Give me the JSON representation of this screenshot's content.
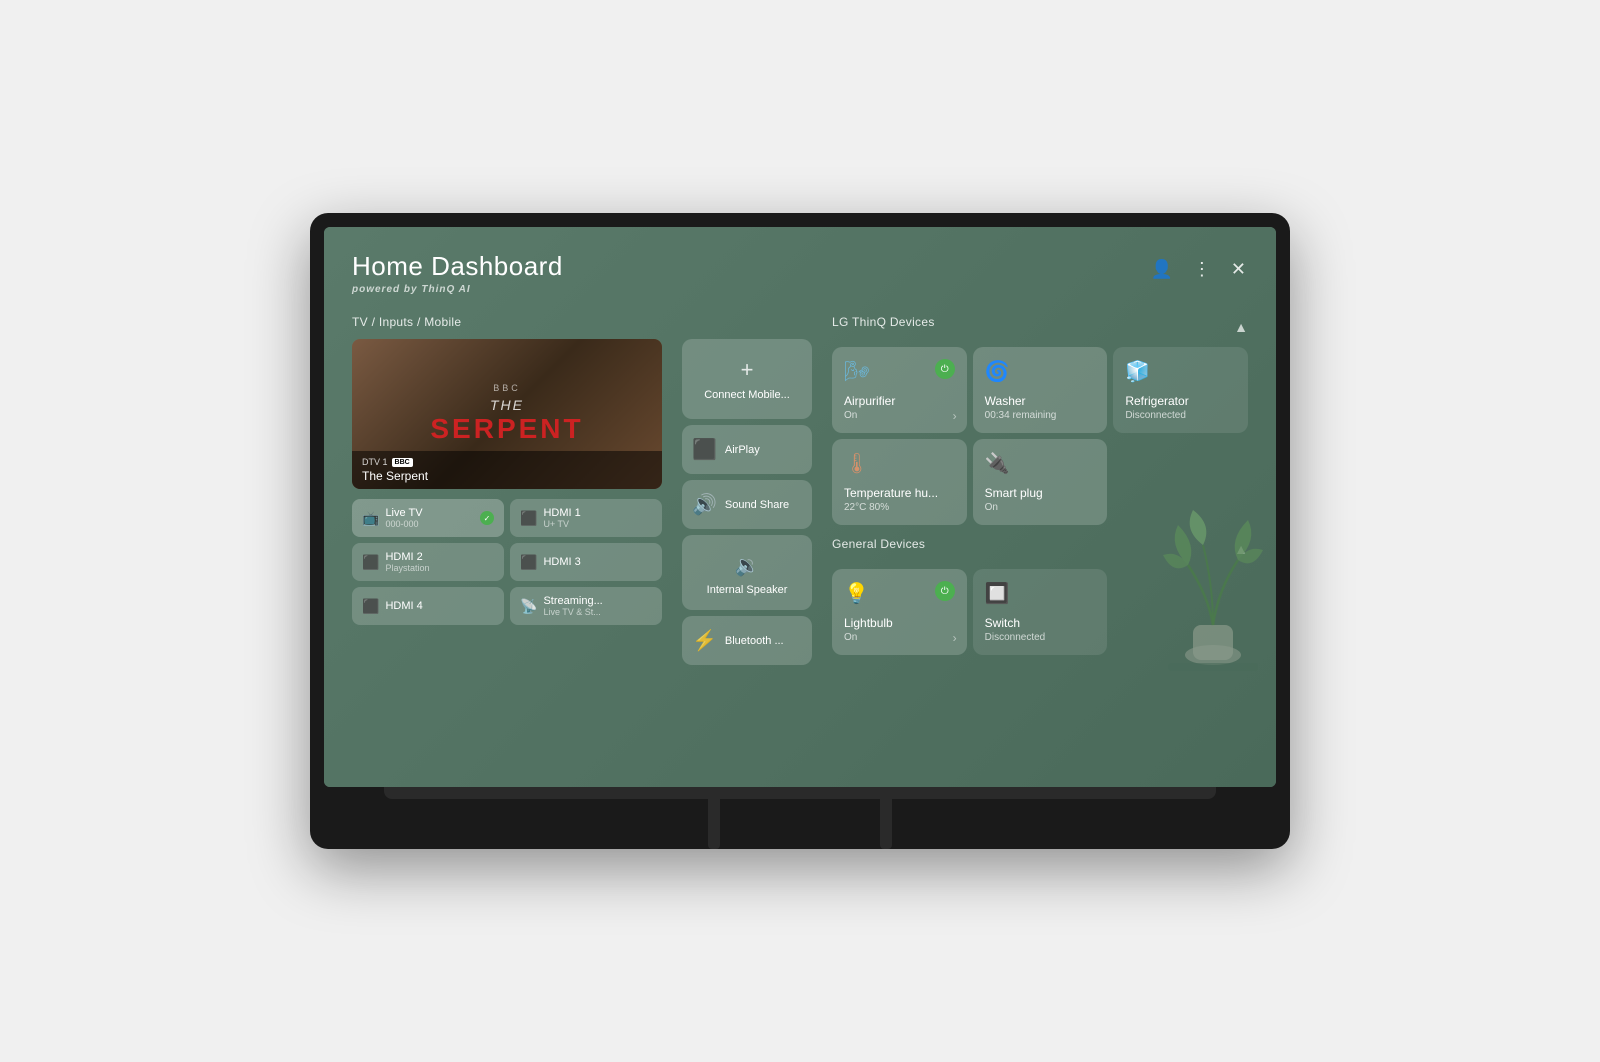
{
  "dashboard": {
    "title": "Home Dashboard",
    "subtitle_pre": "powered by ",
    "subtitle_brand": "ThinQ AI",
    "controls": {
      "account_icon": "👤",
      "more_icon": "⋮",
      "close_icon": "✕"
    }
  },
  "tv_section": {
    "label": "TV / Inputs / Mobile",
    "channel": "DTV 1",
    "channel_badge": "BBC",
    "show_title": "The Serpent",
    "preview_bbc": "BBC",
    "preview_the": "THE",
    "preview_serpent": "SERPENT",
    "inputs": [
      {
        "name": "Live TV",
        "sub": "000-000",
        "icon": "📺",
        "active": true
      },
      {
        "name": "HDMI 1",
        "sub": "U+ TV",
        "icon": "🔌",
        "active": false
      },
      {
        "name": "HDMI 2",
        "sub": "Playstation",
        "icon": "🔌",
        "active": false
      },
      {
        "name": "HDMI 3",
        "sub": "",
        "icon": "🔌",
        "active": false
      },
      {
        "name": "HDMI 4",
        "sub": "",
        "icon": "🔌",
        "active": false
      },
      {
        "name": "Streaming...",
        "sub": "Live TV & St...",
        "icon": "📡",
        "active": false
      }
    ]
  },
  "mobile_section": {
    "connect_label": "Connect Mobile...",
    "connect_icon": "+",
    "airplay_label": "AirPlay",
    "sound_share_label": "Sound Share",
    "internal_speaker_label": "Internal Speaker",
    "bluetooth_label": "Bluetooth ..."
  },
  "thinq_section": {
    "label": "LG ThinQ Devices",
    "devices": [
      {
        "name": "Airpurifier",
        "status": "On",
        "icon": "💨",
        "connected": true,
        "has_power": true,
        "has_arrow": true,
        "icon_class": "airpurifier-icon"
      },
      {
        "name": "Washer",
        "status": "00:34 remaining",
        "icon": "🌀",
        "connected": true,
        "has_power": false,
        "has_arrow": false,
        "icon_class": "washer-icon"
      },
      {
        "name": "Refrigerator",
        "status": "Disconnected",
        "icon": "🧊",
        "connected": false,
        "has_power": false,
        "has_arrow": false,
        "icon_class": "refrigerator-icon"
      },
      {
        "name": "Temperature hu...",
        "status": "22°C 80%",
        "icon": "🌡",
        "connected": true,
        "has_power": false,
        "has_arrow": false,
        "icon_class": "temp-icon"
      },
      {
        "name": "Smart plug",
        "status": "On",
        "icon": "🔌",
        "connected": true,
        "has_power": false,
        "has_arrow": false,
        "icon_class": "smartplug-icon"
      }
    ]
  },
  "general_section": {
    "label": "General Devices",
    "devices": [
      {
        "name": "Lightbulb",
        "status": "On",
        "icon": "💡",
        "connected": true,
        "has_power": true,
        "has_arrow": true,
        "icon_class": "lightbulb-icon"
      },
      {
        "name": "Switch",
        "status": "Disconnected",
        "icon": "🔲",
        "connected": false,
        "has_power": false,
        "has_arrow": false,
        "icon_class": "switch-icon"
      }
    ]
  }
}
